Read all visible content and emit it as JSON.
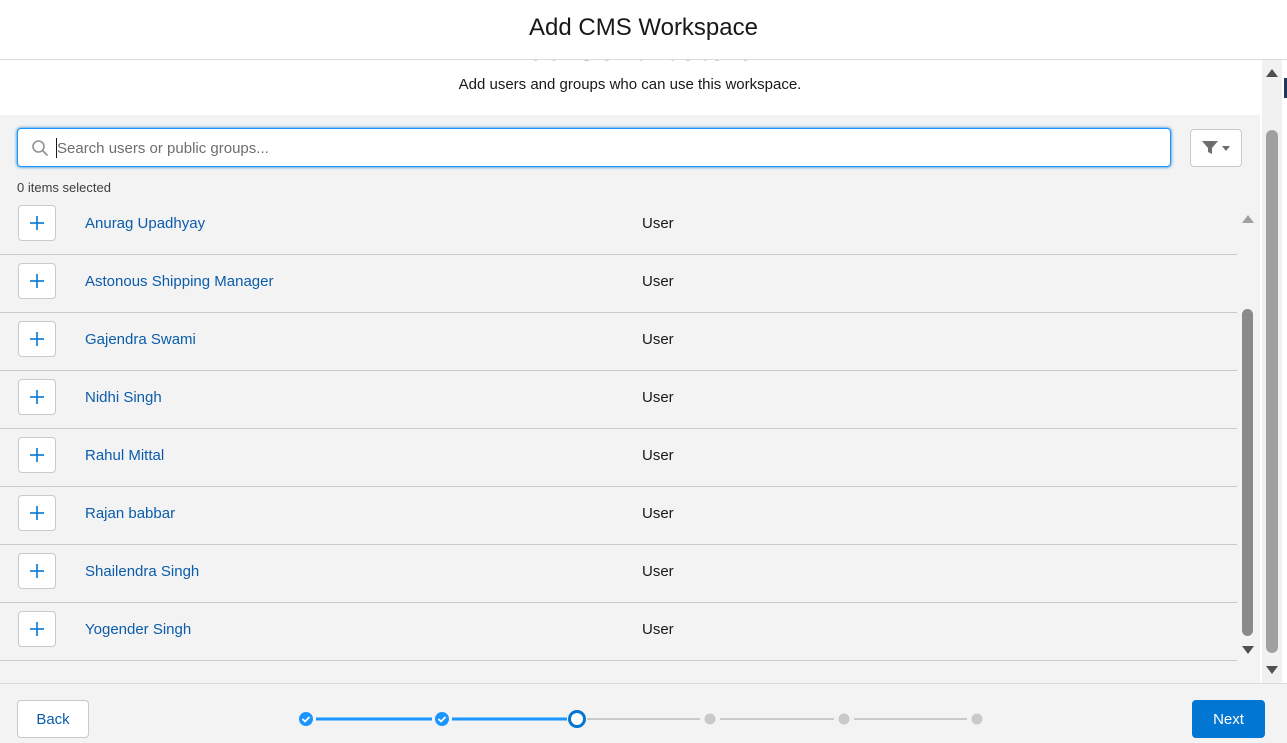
{
  "modal": {
    "title": "Add CMS Workspace"
  },
  "step": {
    "title": "Add Contributors",
    "description": "Add users and groups who can use this workspace."
  },
  "search": {
    "placeholder": "Search users or public groups...",
    "value": ""
  },
  "filter": {
    "icon": "filter-icon"
  },
  "selection": {
    "count_text": "0 items selected"
  },
  "rows": [
    {
      "name": "Anurag Upadhyay",
      "type": "User"
    },
    {
      "name": "Astonous Shipping Manager",
      "type": "User"
    },
    {
      "name": "Gajendra Swami",
      "type": "User"
    },
    {
      "name": "Nidhi Singh",
      "type": "User"
    },
    {
      "name": "Rahul Mittal",
      "type": "User"
    },
    {
      "name": "Rajan babbar",
      "type": "User"
    },
    {
      "name": "Shailendra Singh",
      "type": "User"
    },
    {
      "name": "Yogender Singh",
      "type": "User"
    }
  ],
  "footer": {
    "back_label": "Back",
    "next_label": "Next"
  },
  "progress": {
    "total_steps": 6,
    "completed_steps": 2,
    "current_step": 3
  },
  "colors": {
    "brand": "#0176d3",
    "link": "#0b5cab",
    "progress_active": "#1b96ff",
    "progress_inactive": "#c9c9c9"
  }
}
